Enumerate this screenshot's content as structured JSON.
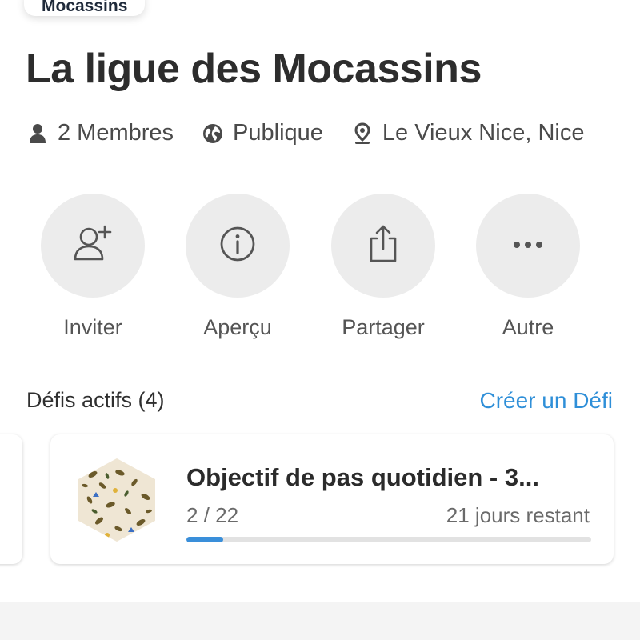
{
  "top_chip": {
    "label": "Mocassins"
  },
  "group": {
    "title": "La ligue des Mocassins",
    "members": "2 Membres",
    "visibility": "Publique",
    "location": "Le Vieux Nice, Nice"
  },
  "actions": [
    {
      "label": "Inviter",
      "icon": "add-person-icon"
    },
    {
      "label": "Aperçu",
      "icon": "info-icon"
    },
    {
      "label": "Partager",
      "icon": "share-icon"
    },
    {
      "label": "Autre",
      "icon": "more-icon"
    }
  ],
  "challenges_section": {
    "title": "Défis actifs (4)",
    "create_label": "Créer un Défi"
  },
  "challenge_card": {
    "name": "Objectif de pas quotidien - 3...",
    "progress_text": "2 / 22",
    "remaining": "21 jours restant",
    "progress_fraction": 0.09
  },
  "colors": {
    "accent": "#2f8fd8",
    "progress_fill": "#3a8fda",
    "button_bg": "#ececec",
    "title_text": "#2d2d2d"
  }
}
